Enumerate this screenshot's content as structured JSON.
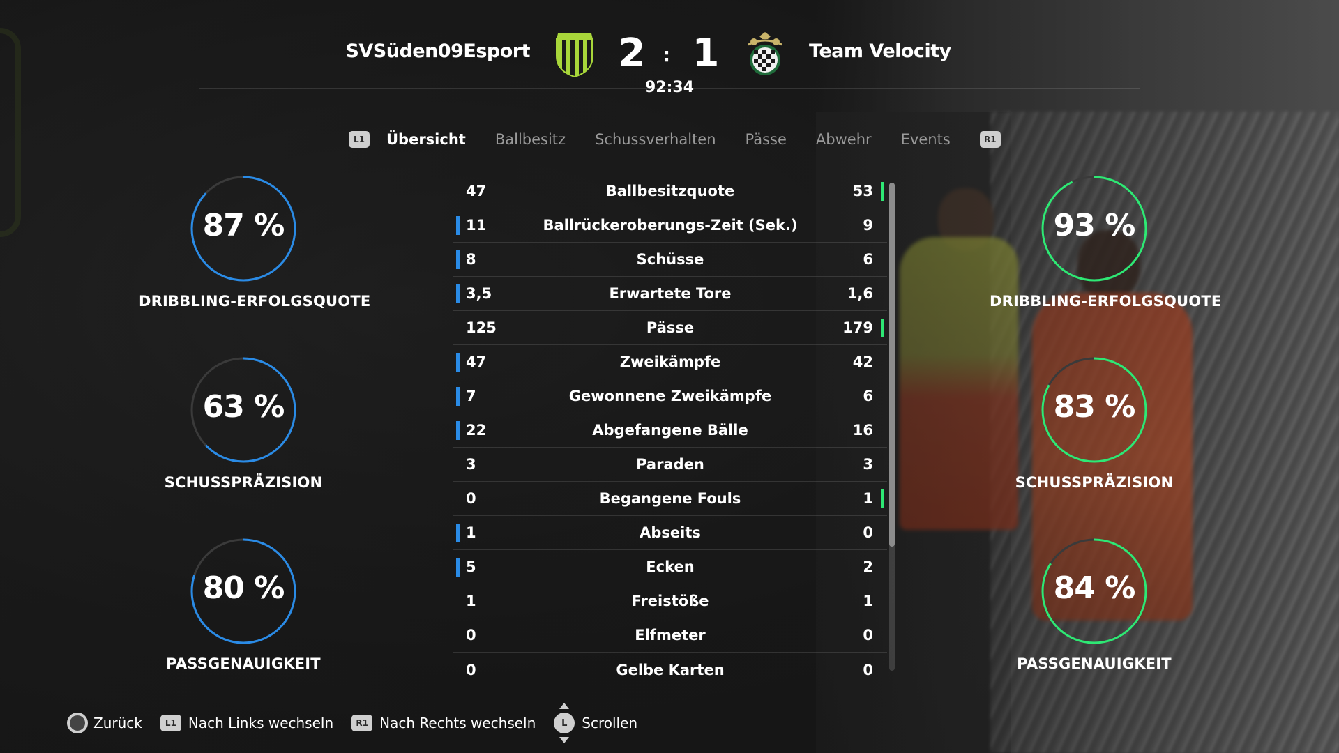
{
  "colors": {
    "home_accent": "#2a8be6",
    "away_accent": "#2ee874",
    "home_crest": "#a8d63a",
    "away_crest": "#2a2a2a"
  },
  "match": {
    "home_team": "SVSüden09Esport",
    "away_team": "Team Velocity",
    "home_score": "2",
    "score_separator": ":",
    "away_score": "1",
    "time": "92:34",
    "home_crest_icon": "shield-striped-crest-icon",
    "away_crest_icon": "checkered-crest-icon"
  },
  "tabs": {
    "left_button": "L1",
    "right_button": "R1",
    "items": [
      {
        "label": "Übersicht",
        "active": true
      },
      {
        "label": "Ballbesitz",
        "active": false
      },
      {
        "label": "Schussverhalten",
        "active": false
      },
      {
        "label": "Pässe",
        "active": false
      },
      {
        "label": "Abwehr",
        "active": false
      },
      {
        "label": "Events",
        "active": false
      }
    ]
  },
  "gauges": {
    "home": [
      {
        "value": 87,
        "text": "87 %",
        "label": "DRIBBLING-ERFOLGSQUOTE"
      },
      {
        "value": 63,
        "text": "63 %",
        "label": "SCHUSSPRÄZISION"
      },
      {
        "value": 80,
        "text": "80 %",
        "label": "PASSGENAUIGKEIT"
      }
    ],
    "away": [
      {
        "value": 93,
        "text": "93 %",
        "label": "DRIBBLING-ERFOLGSQUOTE"
      },
      {
        "value": 83,
        "text": "83 %",
        "label": "SCHUSSPRÄZISION"
      },
      {
        "value": 84,
        "text": "84 %",
        "label": "PASSGENAUIGKEIT"
      }
    ]
  },
  "stats": [
    {
      "home": "47",
      "name": "Ballbesitzquote",
      "away": "53",
      "leader": "away"
    },
    {
      "home": "11",
      "name": "Ballrückeroberungs-Zeit (Sek.)",
      "away": "9",
      "leader": "home"
    },
    {
      "home": "8",
      "name": "Schüsse",
      "away": "6",
      "leader": "home"
    },
    {
      "home": "3,5",
      "name": "Erwartete Tore",
      "away": "1,6",
      "leader": "home"
    },
    {
      "home": "125",
      "name": "Pässe",
      "away": "179",
      "leader": "away"
    },
    {
      "home": "47",
      "name": "Zweikämpfe",
      "away": "42",
      "leader": "home"
    },
    {
      "home": "7",
      "name": "Gewonnene Zweikämpfe",
      "away": "6",
      "leader": "home"
    },
    {
      "home": "22",
      "name": "Abgefangene Bälle",
      "away": "16",
      "leader": "home"
    },
    {
      "home": "3",
      "name": "Paraden",
      "away": "3",
      "leader": "none"
    },
    {
      "home": "0",
      "name": "Begangene Fouls",
      "away": "1",
      "leader": "away"
    },
    {
      "home": "1",
      "name": "Abseits",
      "away": "0",
      "leader": "home"
    },
    {
      "home": "5",
      "name": "Ecken",
      "away": "2",
      "leader": "home"
    },
    {
      "home": "1",
      "name": "Freistöße",
      "away": "1",
      "leader": "none"
    },
    {
      "home": "0",
      "name": "Elfmeter",
      "away": "0",
      "leader": "none"
    },
    {
      "home": "0",
      "name": "Gelbe Karten",
      "away": "0",
      "leader": "none"
    }
  ],
  "footer": {
    "back": {
      "button_icon": "circle-button-icon",
      "label": "Zurück"
    },
    "left": {
      "button": "L1",
      "label": "Nach Links wechseln"
    },
    "right": {
      "button": "R1",
      "label": "Nach Rechts wechseln"
    },
    "scroll": {
      "button": "L",
      "label": "Scrollen"
    }
  }
}
